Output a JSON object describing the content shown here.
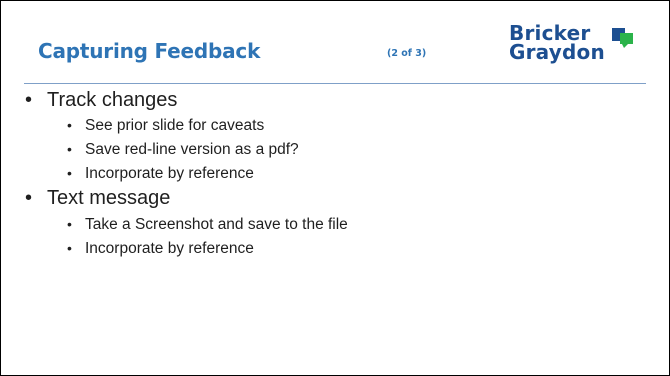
{
  "slide": {
    "title": "Capturing Feedback",
    "page_indicator": "(2 of 3)",
    "logo": {
      "line1": "Bricker",
      "line2": "Graydon",
      "mark_colors": [
        "#1d4f91",
        "#2bb34a"
      ]
    },
    "colors": {
      "title": "#2e74b5",
      "logo_text": "#1d4f91",
      "text": "#1f1f1f"
    },
    "bullets": [
      {
        "text": "Track changes",
        "children": [
          "See prior slide for caveats",
          "Save red-line version as a pdf?",
          "Incorporate by reference"
        ]
      },
      {
        "text": "Text message",
        "children": [
          "Take a Screenshot and save to the file",
          "Incorporate by reference"
        ]
      }
    ],
    "bullet_symbol": "•"
  }
}
